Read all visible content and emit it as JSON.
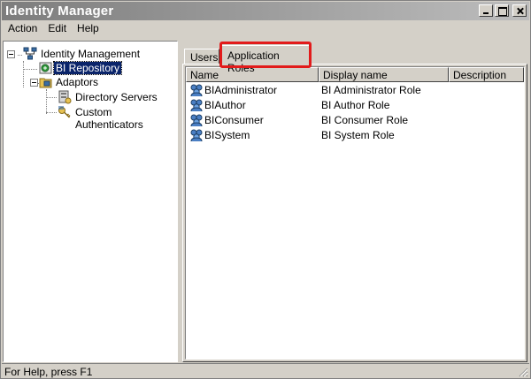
{
  "window": {
    "title": "Identity Manager"
  },
  "menu": [
    {
      "label": "Action"
    },
    {
      "label": "Edit"
    },
    {
      "label": "Help"
    }
  ],
  "tree": {
    "root": "Identity Management",
    "repository": "BI Repository",
    "adaptors": "Adaptors",
    "children": [
      "Directory Servers",
      "Custom Authenticators"
    ]
  },
  "tabs": [
    {
      "label": "Users",
      "active": false
    },
    {
      "label": "Application Roles",
      "active": true
    }
  ],
  "table": {
    "columns": [
      "Name",
      "Display name",
      "Description"
    ],
    "rows": [
      {
        "name": "BIAdministrator",
        "display": "BI Administrator Role",
        "description": ""
      },
      {
        "name": "BIAuthor",
        "display": "BI Author Role",
        "description": ""
      },
      {
        "name": "BIConsumer",
        "display": "BI Consumer Role",
        "description": ""
      },
      {
        "name": "BISystem",
        "display": "BI System Role",
        "description": ""
      }
    ]
  },
  "status": {
    "text": "For Help, press F1"
  },
  "colors": {
    "highlight": "#e21b1b",
    "selection": "#0a246a"
  },
  "icons": {
    "role": "role-group-icon",
    "tree_root": "network-icon",
    "repository": "repository-icon",
    "adaptors": "adaptor-folder-icon",
    "directory": "directory-server-icon",
    "authenticator": "key-icon"
  }
}
